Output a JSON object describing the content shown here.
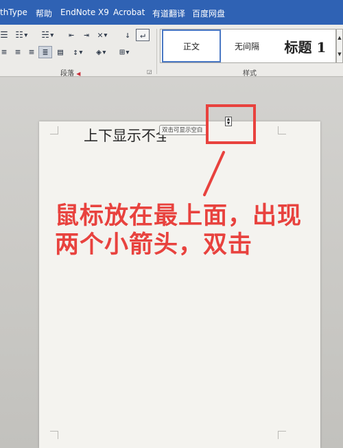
{
  "menubar": {
    "items": [
      "thType",
      "帮助",
      "EndNote X9",
      "Acrobat",
      "有道翻译",
      "百度网盘"
    ]
  },
  "ribbon": {
    "row1_icons": [
      "bullet-list-icon",
      "numbered-list-icon",
      "multilevel-list-icon",
      "decrease-indent-icon",
      "increase-indent-icon",
      "chinese-layout-icon",
      "sort-icon",
      "show-marks-icon"
    ],
    "row2_icons": [
      "align-left-icon",
      "align-center-icon",
      "align-right-icon",
      "justify-icon",
      "distributed-icon",
      "line-spacing-icon",
      "shading-icon",
      "borders-icon"
    ],
    "paragraph_label": "段落",
    "styles_label": "样式",
    "styles": [
      "正文",
      "无间隔",
      "标题 1"
    ]
  },
  "document": {
    "text": "上下显示不全、",
    "tooltip": "双击可显示空白"
  },
  "annotation": {
    "text": "鼠标放在最上面，出现两个小箭头，双击",
    "color": "#e8423e"
  },
  "colors": {
    "menubar": "#2f62b4",
    "ribbon": "#ecebe8",
    "page": "#f4f3ef"
  }
}
